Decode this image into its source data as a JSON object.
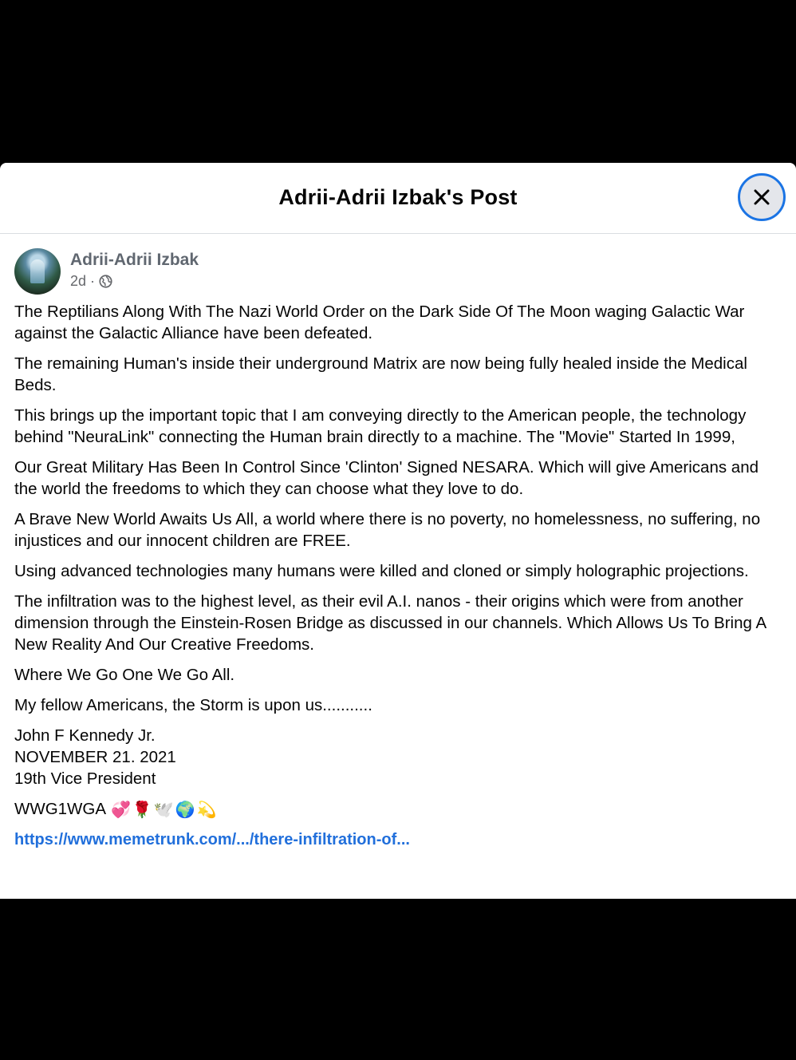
{
  "dialog": {
    "title": "Adrii-Adrii Izbak's Post",
    "close_icon": "close-icon"
  },
  "post": {
    "author": "Adrii-Adrii Izbak",
    "time": "2d",
    "separator": "·",
    "privacy_icon": "globe-icon",
    "paragraphs": [
      "The Reptilians Along With The Nazi World Order on the Dark Side Of The Moon waging Galactic War against the Galactic Alliance have been defeated.",
      "The remaining Human's inside their underground Matrix are now being fully healed inside the Medical Beds.",
      "This brings up the important topic that I am conveying directly to the American people, the technology behind \"NeuraLink\" connecting the Human brain directly to a machine. The \"Movie\" Started In 1999,",
      "Our Great Military Has Been In Control Since 'Clinton' Signed NESARA. Which will give Americans and the world the freedoms to which they can choose what they love to do.",
      "A Brave New World Awaits Us All, a world where there is no poverty, no homelessness, no suffering, no injustices and our innocent children are FREE.",
      "Using advanced technologies many humans were killed and cloned or simply holographic projections.",
      "The infiltration was to the highest level, as their evil A.I. nanos - their origins which were from another dimension through the Einstein-Rosen Bridge as discussed in our channels. Which Allows Us To Bring A New Reality And Our Creative Freedoms.",
      "Where We Go One We Go All.",
      "My fellow Americans, the Storm is upon us..........."
    ],
    "signature": [
      "John F Kennedy Jr.",
      "NOVEMBER 21. 2021",
      "19th Vice President"
    ],
    "hashtag_line": "WWG1WGA",
    "emojis": [
      "💞",
      "🌹",
      "🕊️",
      "🌍",
      "💫"
    ],
    "link": "https://www.memetrunk.com/.../there-infiltration-of..."
  },
  "colors": {
    "link": "#216fdb",
    "focus_ring": "#1b74e4",
    "secondary_text": "#65676b"
  }
}
